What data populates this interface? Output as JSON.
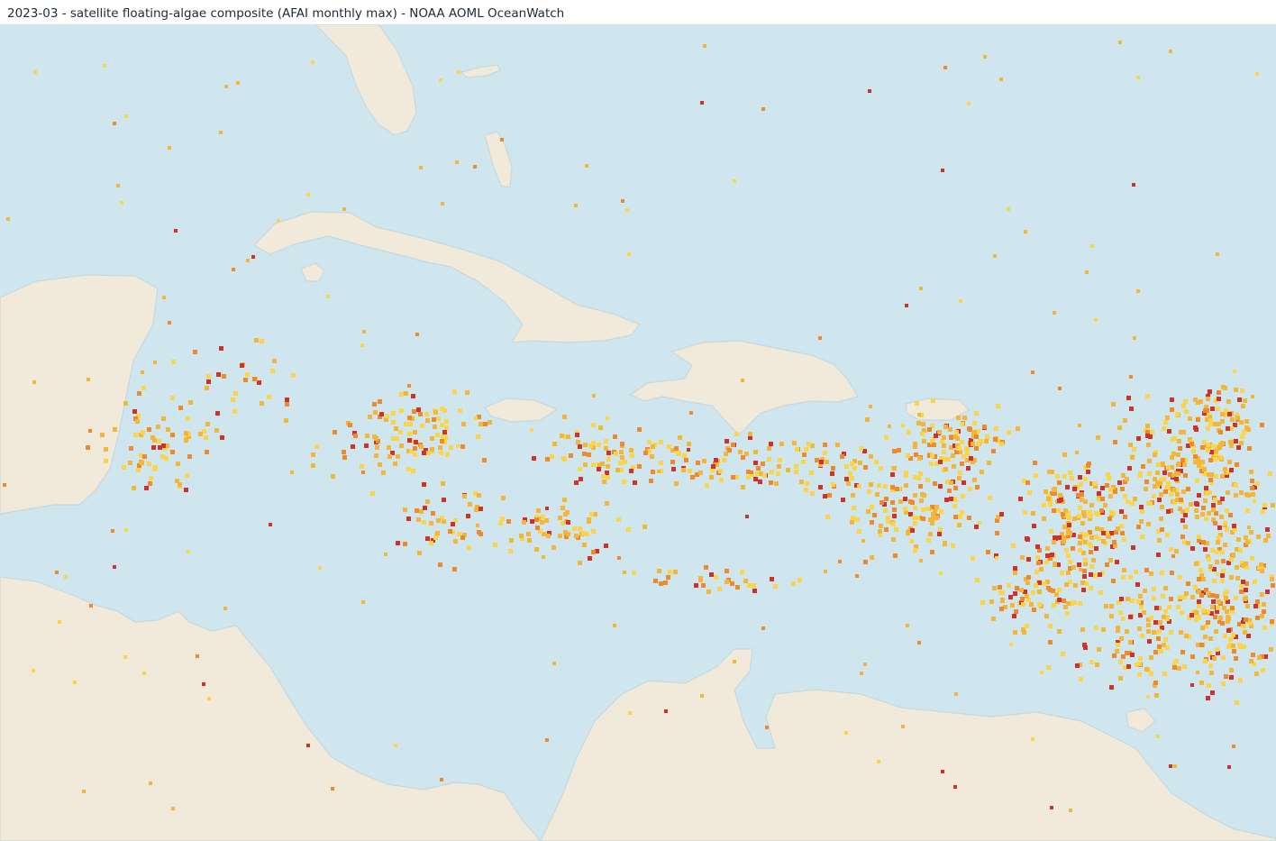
{
  "title": "2023-03 - satellite floating-algae composite (AFAI monthly max) - NOAA AOML OceanWatch",
  "colors": {
    "ocean": "#cfe6ee",
    "land": "#f1e9da",
    "coast": "#c6d8df",
    "algae_low": "#fbd44a",
    "algae_mid": "#f4b63a",
    "algae_high": "#ee8a2c",
    "algae_max": "#d0322a"
  }
}
